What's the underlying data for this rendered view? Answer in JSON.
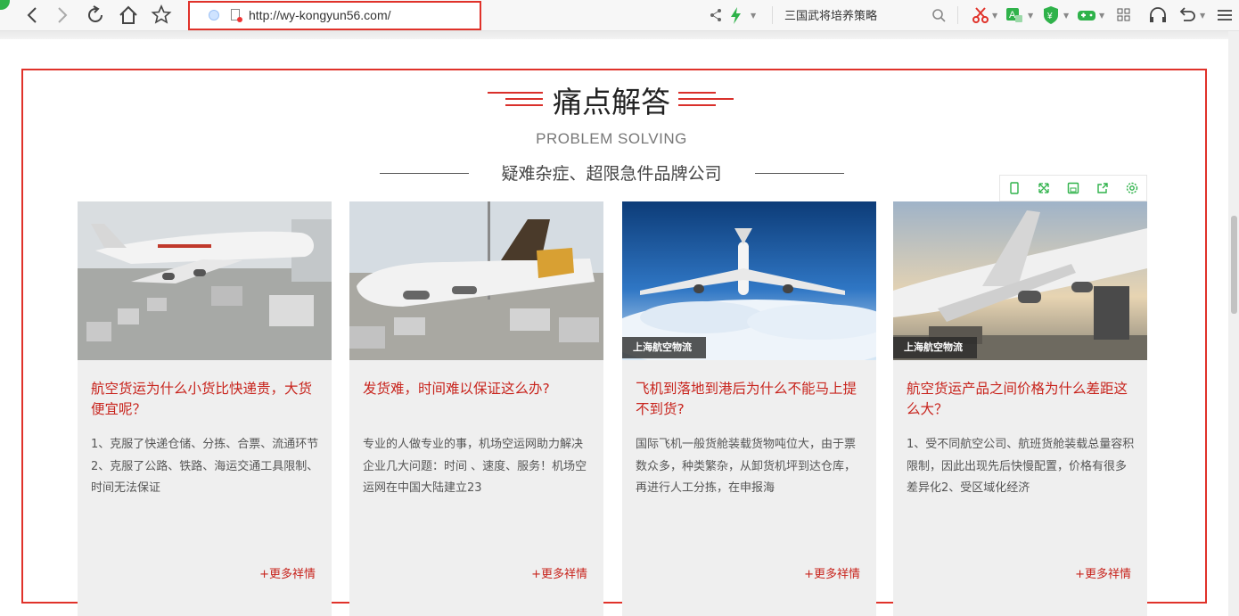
{
  "browser": {
    "url": "http://wy-kongyun56.com/",
    "search_text": "三国武将培养策略"
  },
  "section": {
    "title": "痛点解答",
    "subtitle_en": "PROBLEM SOLVING",
    "subtitle_cn": "疑难杂症、超限急件品牌公司"
  },
  "cards": [
    {
      "title": "航空货运为什么小货比快递贵，大货便宜呢？",
      "desc": "1、克服了快递仓储、分拣、合票、流通环节2、克服了公路、铁路、海运交通工具限制、时间无法保证",
      "badge": "",
      "more": "+更多祥情"
    },
    {
      "title": "发货难，时间难以保证这么办?",
      "desc": "专业的人做专业的事，机场空运网助力解决企业几大问题：时间 、速度、服务！机场空运网在中国大陆建立23",
      "badge": "",
      "more": "+更多祥情"
    },
    {
      "title": "飞机到落地到港后为什么不能马上提不到货?",
      "desc": "国际飞机一般货舱装载货物吨位大，由于票数众多，种类繁杂，从卸货机坪到达仓库，再进行人工分拣，在申报海",
      "badge": "上海航空物流",
      "more": "+更多祥情"
    },
    {
      "title": "航空货运产品之间价格为什么差距这么大？",
      "desc": "1、受不同航空公司、航班货舱装载总量容积限制，因此出现先后快慢配置，价格有很多差异化2、受区域化经济",
      "badge": "上海航空物流",
      "more": "+更多祥情"
    }
  ],
  "colors": {
    "accent_red": "#e0322a",
    "title_red": "#c8241d",
    "card_bg": "#efefef"
  }
}
